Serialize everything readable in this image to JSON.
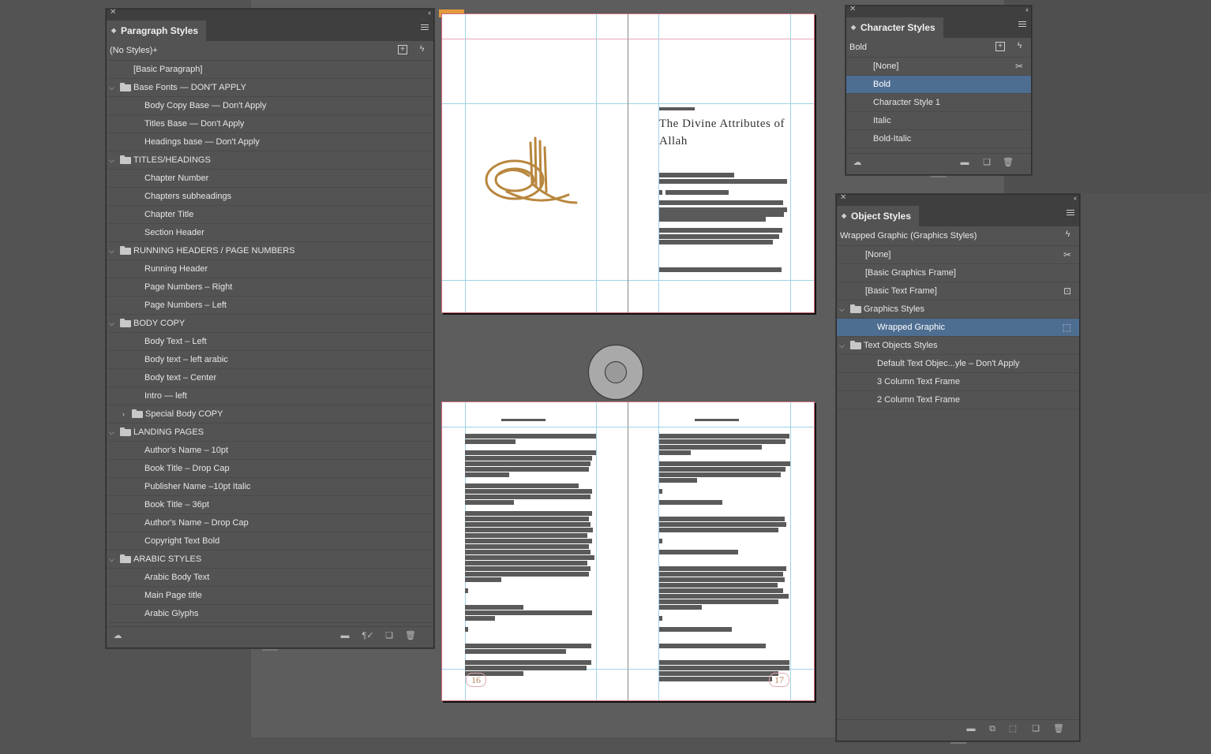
{
  "paragraph_styles": {
    "title": "Paragraph Styles",
    "current": "(No Styles)+",
    "items": [
      {
        "label": "[Basic Paragraph]",
        "level": 1,
        "folder": false,
        "expanded": null
      },
      {
        "label": "Base Fonts — DON'T APPLY",
        "level": 0,
        "folder": true,
        "expanded": true
      },
      {
        "label": "Body Copy Base — Don't Apply",
        "level": 2,
        "folder": false,
        "expanded": null
      },
      {
        "label": "Titles Base — Don't Apply",
        "level": 2,
        "folder": false,
        "expanded": null
      },
      {
        "label": "Headings base — Don't Apply",
        "level": 2,
        "folder": false,
        "expanded": null
      },
      {
        "label": "TITLES/HEADINGS",
        "level": 0,
        "folder": true,
        "expanded": true
      },
      {
        "label": "Chapter Number",
        "level": 2,
        "folder": false,
        "expanded": null
      },
      {
        "label": "Chapters subheadings",
        "level": 2,
        "folder": false,
        "expanded": null
      },
      {
        "label": "Chapter Title",
        "level": 2,
        "folder": false,
        "expanded": null
      },
      {
        "label": "Section Header",
        "level": 2,
        "folder": false,
        "expanded": null
      },
      {
        "label": "RUNNING HEADERS / PAGE NUMBERS",
        "level": 0,
        "folder": true,
        "expanded": true
      },
      {
        "label": "Running Header",
        "level": 2,
        "folder": false,
        "expanded": null
      },
      {
        "label": "Page Numbers – Right",
        "level": 2,
        "folder": false,
        "expanded": null
      },
      {
        "label": "Page Numbers – Left",
        "level": 2,
        "folder": false,
        "expanded": null
      },
      {
        "label": "BODY COPY",
        "level": 0,
        "folder": true,
        "expanded": true
      },
      {
        "label": "Body Text – Left",
        "level": 2,
        "folder": false,
        "expanded": null
      },
      {
        "label": "Body text – left arabic",
        "level": 2,
        "folder": false,
        "expanded": null
      },
      {
        "label": "Body text – Center",
        "level": 2,
        "folder": false,
        "expanded": null
      },
      {
        "label": "Intro — left",
        "level": 2,
        "folder": false,
        "expanded": null
      },
      {
        "label": "Special Body COPY",
        "level": 1,
        "folder": true,
        "expanded": false
      },
      {
        "label": "LANDING PAGES",
        "level": 0,
        "folder": true,
        "expanded": true
      },
      {
        "label": "Author's Name – 10pt",
        "level": 2,
        "folder": false,
        "expanded": null
      },
      {
        "label": "Book Title – Drop Cap",
        "level": 2,
        "folder": false,
        "expanded": null
      },
      {
        "label": "Publisher Name –10pt Italic",
        "level": 2,
        "folder": false,
        "expanded": null
      },
      {
        "label": "Book Title – 36pt",
        "level": 2,
        "folder": false,
        "expanded": null
      },
      {
        "label": "Author's Name – Drop Cap",
        "level": 2,
        "folder": false,
        "expanded": null
      },
      {
        "label": "Copyright Text Bold",
        "level": 2,
        "folder": false,
        "expanded": null
      },
      {
        "label": "ARABIC STYLES",
        "level": 0,
        "folder": true,
        "expanded": true
      },
      {
        "label": "Arabic Body Text",
        "level": 2,
        "folder": false,
        "expanded": null
      },
      {
        "label": "Main Page title",
        "level": 2,
        "folder": false,
        "expanded": null
      },
      {
        "label": "Arabic Glyphs",
        "level": 2,
        "folder": false,
        "expanded": null
      }
    ]
  },
  "character_styles": {
    "title": "Character Styles",
    "current": "Bold",
    "items": [
      "[None]",
      "Bold",
      "Character Style 1",
      "Italic",
      "Bold-Italic"
    ],
    "selected": "Bold"
  },
  "object_styles": {
    "title": "Object Styles",
    "current": "Wrapped Graphic (Graphics Styles)",
    "items": [
      {
        "label": "[None]",
        "level": 1,
        "folder": false,
        "expanded": null,
        "selected": false
      },
      {
        "label": "[Basic Graphics Frame]",
        "level": 1,
        "folder": false,
        "expanded": null,
        "selected": false
      },
      {
        "label": "[Basic Text Frame]",
        "level": 1,
        "folder": false,
        "expanded": null,
        "selected": false
      },
      {
        "label": "Graphics Styles",
        "level": 0,
        "folder": true,
        "expanded": true,
        "selected": false
      },
      {
        "label": "Wrapped Graphic",
        "level": 2,
        "folder": false,
        "expanded": null,
        "selected": true
      },
      {
        "label": "Text Objects Styles",
        "level": 0,
        "folder": true,
        "expanded": true,
        "selected": false
      },
      {
        "label": "Default Text Objec...yle – Don't Apply",
        "level": 2,
        "folder": false,
        "expanded": null,
        "selected": false
      },
      {
        "label": "3 Column Text Frame",
        "level": 2,
        "folder": false,
        "expanded": null,
        "selected": false
      },
      {
        "label": "2 Column Text Frame",
        "level": 2,
        "folder": false,
        "expanded": null,
        "selected": false
      }
    ]
  },
  "document": {
    "chapter_title": "The Divine Attributes of Allah",
    "folio_left": "16",
    "folio_right": "17"
  },
  "colors": {
    "selection": "#4e6e91",
    "guide_cyan": "#9fd4e6",
    "margin_pink": "#e7a9b4",
    "calligraphy_gold": "#b8873e",
    "page_tab_orange": "#e39a3c"
  }
}
